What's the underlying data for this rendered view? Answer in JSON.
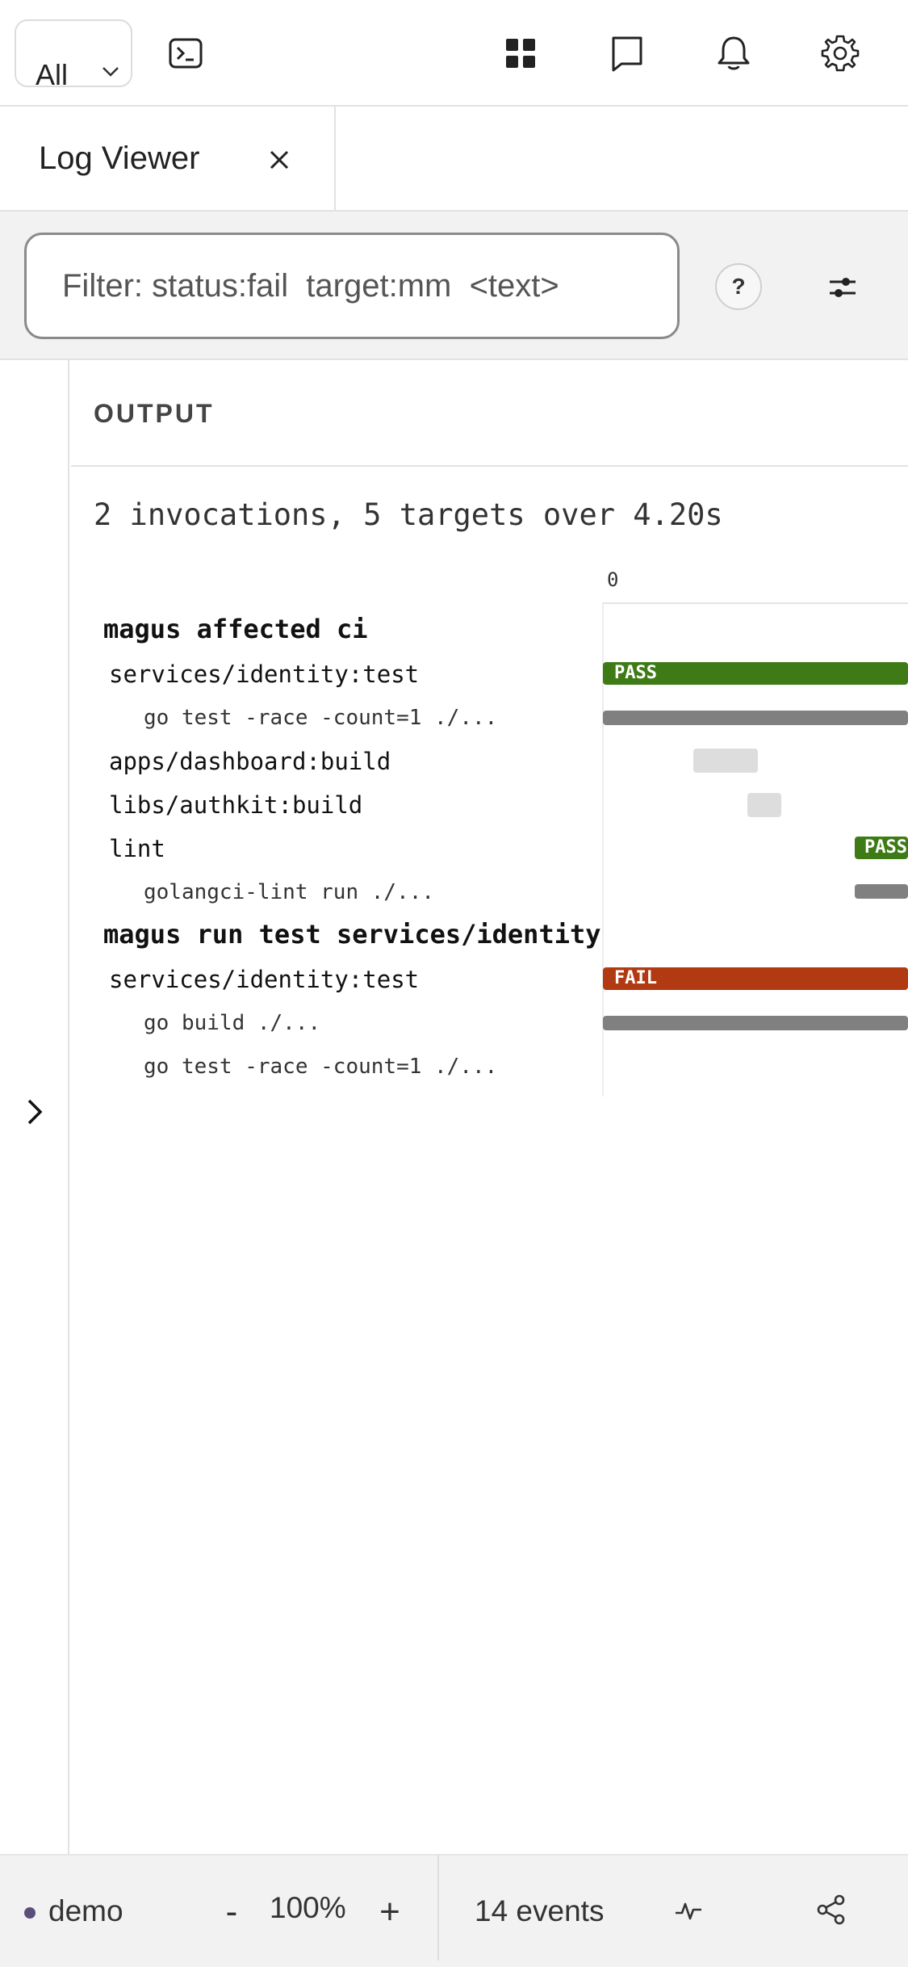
{
  "toolbar": {
    "scope_label": "All",
    "icons": [
      "terminal-icon",
      "grid-icon",
      "book-icon",
      "bell-icon",
      "gear-icon"
    ]
  },
  "tabs": [
    {
      "label": "Log Viewer",
      "close": "×"
    }
  ],
  "filter": {
    "value": "Filter: status:fail  target:mm  <text>"
  },
  "help": {
    "label": "?"
  },
  "output": {
    "header": "OUTPUT",
    "summary": "2 invocations, 5 targets over 4.20s",
    "timeline_start": "0",
    "rows": [
      {
        "text": "magus affected ci",
        "level": 0
      },
      {
        "text": "services/identity:test",
        "level": 1,
        "status": "PASS"
      },
      {
        "text": "go test -race -count=1 ./...",
        "level": 2
      },
      {
        "text": "apps/dashboard:build",
        "level": 1
      },
      {
        "text": "libs/authkit:build",
        "level": 1
      },
      {
        "text": "lint",
        "level": 1,
        "status": "PASS"
      },
      {
        "text": "golangci-lint run ./...",
        "level": 2
      },
      {
        "text": "magus run test services/identity",
        "level": 0
      },
      {
        "text": "services/identity:test",
        "level": 1,
        "status": "FAIL"
      },
      {
        "text": "go build ./...",
        "level": 2
      },
      {
        "text": "go test -race -count=1 ./...",
        "level": 2
      }
    ]
  },
  "footer": {
    "workspace": "demo",
    "zoom": "100%",
    "zoom_out": "-",
    "zoom_in": "+",
    "events": "14 events"
  },
  "colors": {
    "pass": "#3e7b16",
    "fail": "#b23a12",
    "command": "#808080",
    "pending": "#dddddd",
    "workspace_dot": "#5a4f7a"
  }
}
